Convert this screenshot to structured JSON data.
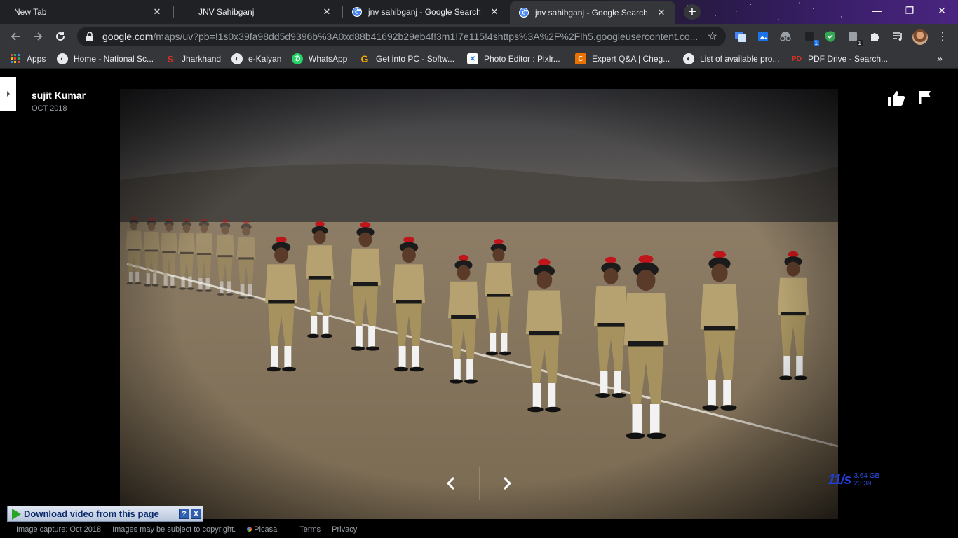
{
  "browser": {
    "tabs": [
      {
        "title": "New Tab",
        "active": false,
        "icon": "none"
      },
      {
        "title": "JNV Sahibganj",
        "active": false,
        "icon": "none"
      },
      {
        "title": "jnv sahibganj - Google Search",
        "active": false,
        "icon": "google-icon"
      },
      {
        "title": "jnv sahibganj - Google Search",
        "active": true,
        "icon": "google-icon"
      }
    ],
    "new_tab_label": "+",
    "window_controls": {
      "minimize": "—",
      "restore": "❐",
      "close": "✕"
    },
    "address": {
      "host": "google.com",
      "path": "/maps/uv?pb=!1s0x39fa98dd5d9396b%3A0xd88b41692b29eb4f!3m1!7e115!4shttps%3A%2F%2Flh5.googleusercontent.co..."
    },
    "extension_badges": {
      "ext_5": "1",
      "ext_7": "1"
    }
  },
  "bookmarks": [
    {
      "label": "Apps",
      "icon": "apps-grid-icon"
    },
    {
      "label": "Home - National Sc...",
      "icon": "globe-icon"
    },
    {
      "label": "Jharkhand",
      "icon": "s-logo-icon"
    },
    {
      "label": "e-Kalyan",
      "icon": "globe-icon"
    },
    {
      "label": "WhatsApp",
      "icon": "whatsapp-icon"
    },
    {
      "label": "Get into PC - Softw...",
      "icon": "g-logo-icon"
    },
    {
      "label": "Photo Editor : Pixlr...",
      "icon": "pixlr-icon"
    },
    {
      "label": "Expert Q&A | Cheg...",
      "icon": "chegg-icon"
    },
    {
      "label": "List of available pro...",
      "icon": "globe-icon"
    },
    {
      "label": "PDF Drive - Search...",
      "icon": "pdfdrive-icon"
    }
  ],
  "viewer": {
    "author": "sujit Kumar",
    "date": "OCT 2018",
    "download_label": "Download video from this page",
    "download_help": "?",
    "download_close": "X",
    "speed": {
      "main": "11/s",
      "size": "3.64 GB",
      "time": "23:39"
    },
    "footer": {
      "capture": "Image capture: Oct 2018",
      "copyright": "Images may be subject to copyright.",
      "picasa": "Picasa",
      "terms": "Terms",
      "privacy": "Privacy"
    }
  },
  "colors": {
    "accent": "#1a73e8",
    "tab_bg": "#202124",
    "toolbar_bg": "#35363a"
  }
}
